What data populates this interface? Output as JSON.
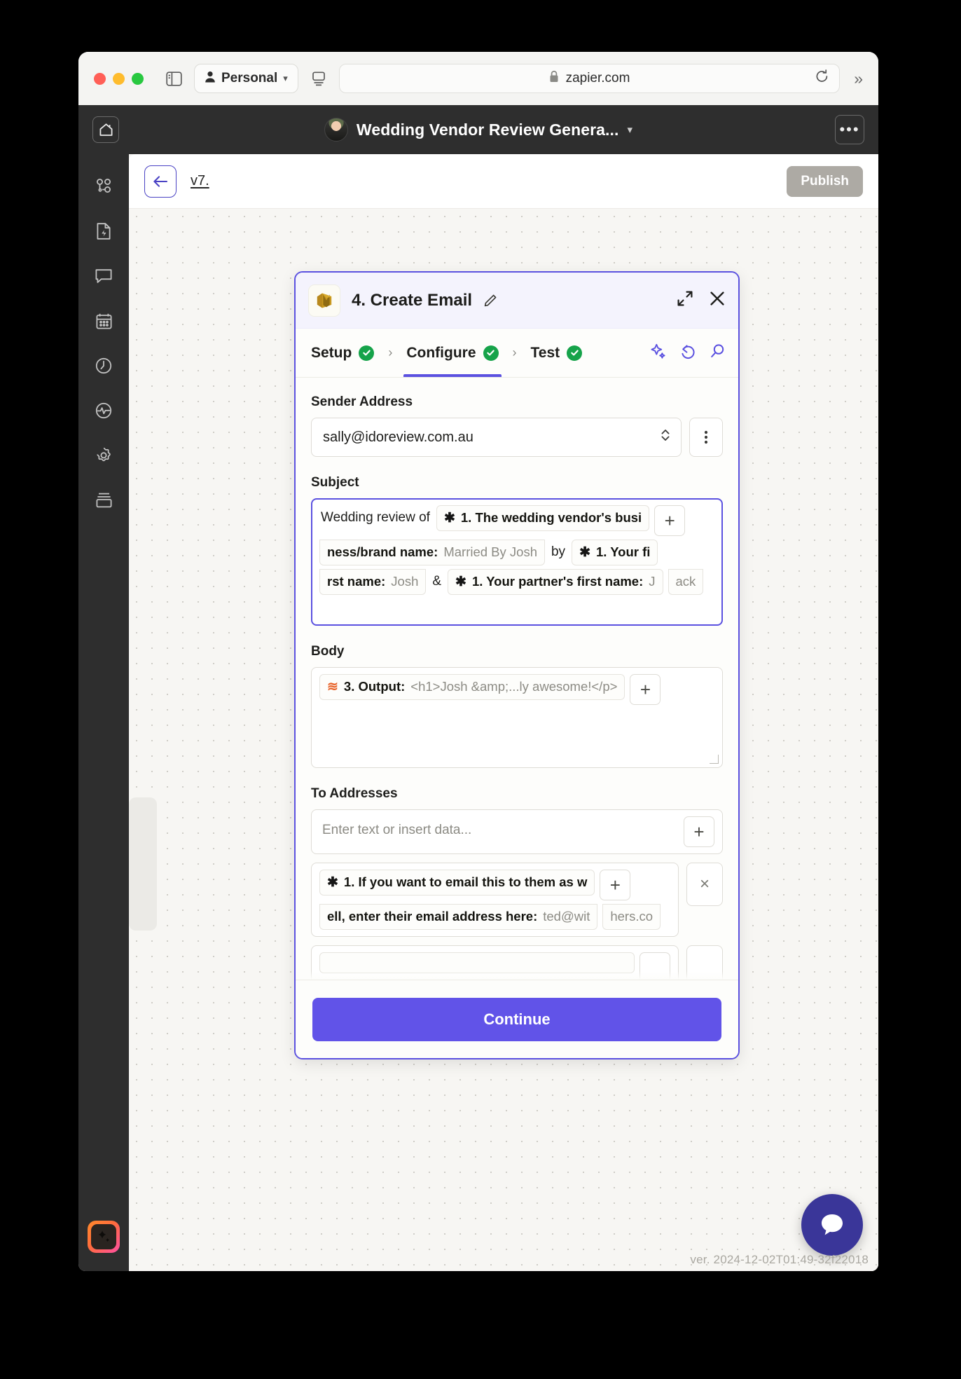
{
  "browser": {
    "profile_label": "Personal",
    "profile_icon": "person-icon",
    "sidebar_toggle_icon": "sidebar-toggle-icon",
    "tab_overview_icon": "tab-overview-icon",
    "lock_icon": "lock-icon",
    "url": "zapier.com",
    "reload_icon": "reload-icon",
    "overflow_icon": "chevron-double-right-icon",
    "traffic_lights": [
      "close-red",
      "minimize-yellow",
      "zoom-green"
    ]
  },
  "app_header": {
    "home_icon": "home-icon",
    "avatar": "user-avatar",
    "title": "Wedding Vendor Review Genera...",
    "title_chevron": "chevron-down-icon",
    "more_label": "•••"
  },
  "sidebar": {
    "items": [
      {
        "icon": "zaps-icon",
        "name": "sidebar-item-zaps"
      },
      {
        "icon": "document-bolt-icon",
        "name": "sidebar-item-interfaces"
      },
      {
        "icon": "chat-icon",
        "name": "sidebar-item-chatbots"
      },
      {
        "icon": "calendar-icon",
        "name": "sidebar-item-tables"
      },
      {
        "icon": "clock-icon",
        "name": "sidebar-item-history"
      },
      {
        "icon": "pulse-icon",
        "name": "sidebar-item-analytics"
      },
      {
        "icon": "gear-icon",
        "name": "sidebar-item-settings"
      },
      {
        "icon": "storage-icon",
        "name": "sidebar-item-storage"
      }
    ],
    "ai_button_icon": "sparkle-icon"
  },
  "toolbar": {
    "back_icon": "arrow-left-icon",
    "version_label": "v7.",
    "publish_label": "Publish"
  },
  "modal": {
    "app_icon": "aws-ses-icon",
    "step_title": "4. Create Email",
    "edit_icon": "pencil-icon",
    "expand_icon": "expand-icon",
    "close_icon": "close-icon",
    "tabs": [
      {
        "label": "Setup",
        "status": "complete",
        "active": false
      },
      {
        "label": "Configure",
        "status": "complete",
        "active": true
      },
      {
        "label": "Test",
        "status": "complete",
        "active": false
      }
    ],
    "tab_separator": "›",
    "tab_icons": [
      {
        "icon": "ai-sparkle-icon",
        "name": "ai-assist-button"
      },
      {
        "icon": "undo-icon",
        "name": "undo-button"
      },
      {
        "icon": "search-icon",
        "name": "search-button"
      }
    ],
    "check_glyph": "✓"
  },
  "form": {
    "sender": {
      "label": "Sender Address",
      "value": "sally@idoreview.com.au",
      "dropdown_icon": "chevron-updown-icon",
      "kebab_icon": "kebab-menu-icon"
    },
    "subject": {
      "label": "Subject",
      "lead_text": "Wedding review of",
      "chip1_part1_icon": "✱",
      "chip1_part1_label": "1. The wedding vendor's busi",
      "chip1_part2_label": "ness/brand name:",
      "chip1_part2_value": "Married By Josh",
      "join_text": "by",
      "chip2_part1_icon": "✱",
      "chip2_part1_label": "1. Your fi",
      "chip2_part2_label": "rst name:",
      "chip2_part2_value": "Josh",
      "amp_text": "&",
      "chip3_icon": "✱",
      "chip3_label": "1. Your partner's first name:",
      "chip3_value": "J",
      "chip3_overflow": "ack",
      "add_icon": "+"
    },
    "body": {
      "label": "Body",
      "chip_icon": "≋",
      "chip_label": "3. Output:",
      "chip_value": "<h1>Josh &amp;...ly awesome!</p>",
      "add_icon": "+"
    },
    "to_addresses": {
      "label": "To Addresses",
      "placeholder": "Enter text or insert data...",
      "add_icon": "+",
      "row2": {
        "chip_icon": "✱",
        "chip_part1_label": "1. If you want to email this to them as w",
        "chip_part2_label": "ell, enter their email address here:",
        "chip_part2_value": "ted@wit",
        "chip_part3_value": "hers.co",
        "add_icon": "+",
        "remove_icon": "×"
      }
    }
  },
  "footer": {
    "continue_label": "Continue",
    "chat_icon": "chat-bubble-icon",
    "version_text": "ver. 2024-12-02T01:49-32f22018"
  },
  "colors": {
    "accent_purple": "#5b51e0",
    "continue_purple": "#6153e8",
    "success_green": "#16a34a",
    "publish_grey": "#adaaa4",
    "dark_chrome": "#2e2e2e",
    "chip_orange": "#e8632a"
  }
}
